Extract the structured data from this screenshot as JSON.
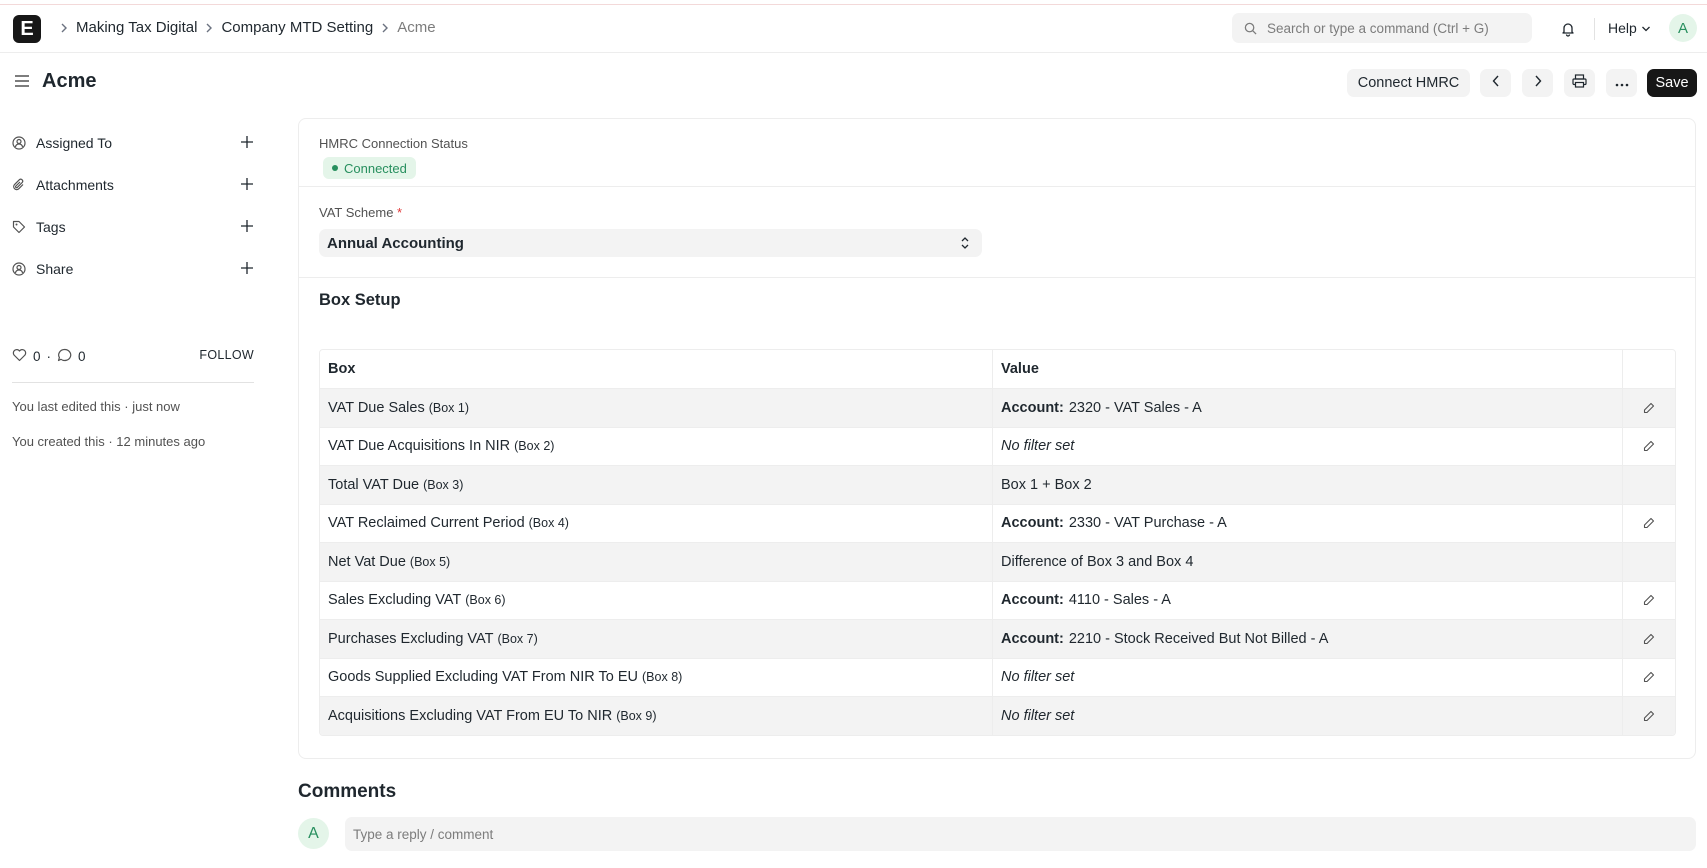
{
  "navbar": {
    "logo_letter": "E",
    "breadcrumbs": [
      "Making Tax Digital",
      "Company MTD Setting",
      "Acme"
    ],
    "search_placeholder": "Search or type a command (Ctrl + G)",
    "help_label": "Help",
    "avatar_letter": "A"
  },
  "page": {
    "title": "Acme",
    "connect_label": "Connect HMRC",
    "save_label": "Save"
  },
  "sidebar": {
    "items": [
      {
        "label": "Assigned To",
        "icon": "assign-icon"
      },
      {
        "label": "Attachments",
        "icon": "paperclip-icon"
      },
      {
        "label": "Tags",
        "icon": "tag-icon"
      },
      {
        "label": "Share",
        "icon": "share-icon"
      }
    ],
    "likes": "0",
    "comments": "0",
    "follow_label": "FOLLOW",
    "last_edited": "You last edited this · just now",
    "created": "You created this · 12 minutes ago"
  },
  "form": {
    "connection_label": "HMRC Connection Status",
    "connection_status": "Connected",
    "vat_scheme_label": "VAT Scheme",
    "vat_scheme_required": "*",
    "vat_scheme_value": "Annual Accounting",
    "box_setup_title": "Box Setup",
    "table": {
      "headers": [
        "Box",
        "Value"
      ],
      "rows": [
        {
          "name": "VAT Due Sales",
          "box": "(Box 1)",
          "account_label": "Account:",
          "value": "2320 - VAT Sales - A",
          "editable": true
        },
        {
          "name": "VAT Due Acquisitions In NIR",
          "box": "(Box 2)",
          "account_label": "",
          "value": "No filter set",
          "editable": true
        },
        {
          "name": "Total VAT Due",
          "box": "(Box 3)",
          "account_label": "",
          "value": "Box 1 + Box 2",
          "editable": false
        },
        {
          "name": "VAT Reclaimed Current Period",
          "box": "(Box 4)",
          "account_label": "Account:",
          "value": "2330 - VAT Purchase - A",
          "editable": true
        },
        {
          "name": "Net Vat Due",
          "box": "(Box 5)",
          "account_label": "",
          "value": "Difference of Box 3 and Box 4",
          "editable": false
        },
        {
          "name": "Sales Excluding VAT",
          "box": "(Box 6)",
          "account_label": "Account:",
          "value": "4110 - Sales - A",
          "editable": true
        },
        {
          "name": "Purchases Excluding VAT",
          "box": "(Box 7)",
          "account_label": "Account:",
          "value": "2210 - Stock Received But Not Billed - A",
          "editable": true
        },
        {
          "name": "Goods Supplied Excluding VAT From NIR To EU",
          "box": "(Box 8)",
          "account_label": "",
          "value": "No filter set",
          "editable": true
        },
        {
          "name": "Acquisitions Excluding VAT From EU To NIR",
          "box": "(Box 9)",
          "account_label": "",
          "value": "No filter set",
          "editable": true
        }
      ]
    }
  },
  "comments": {
    "title": "Comments",
    "avatar_letter": "A",
    "placeholder": "Type a reply / comment"
  },
  "colors": {
    "accent_dark": "#171717",
    "success_bg": "#e4f5e9",
    "success_text": "#278f5e",
    "surface": "#f3f3f3"
  }
}
